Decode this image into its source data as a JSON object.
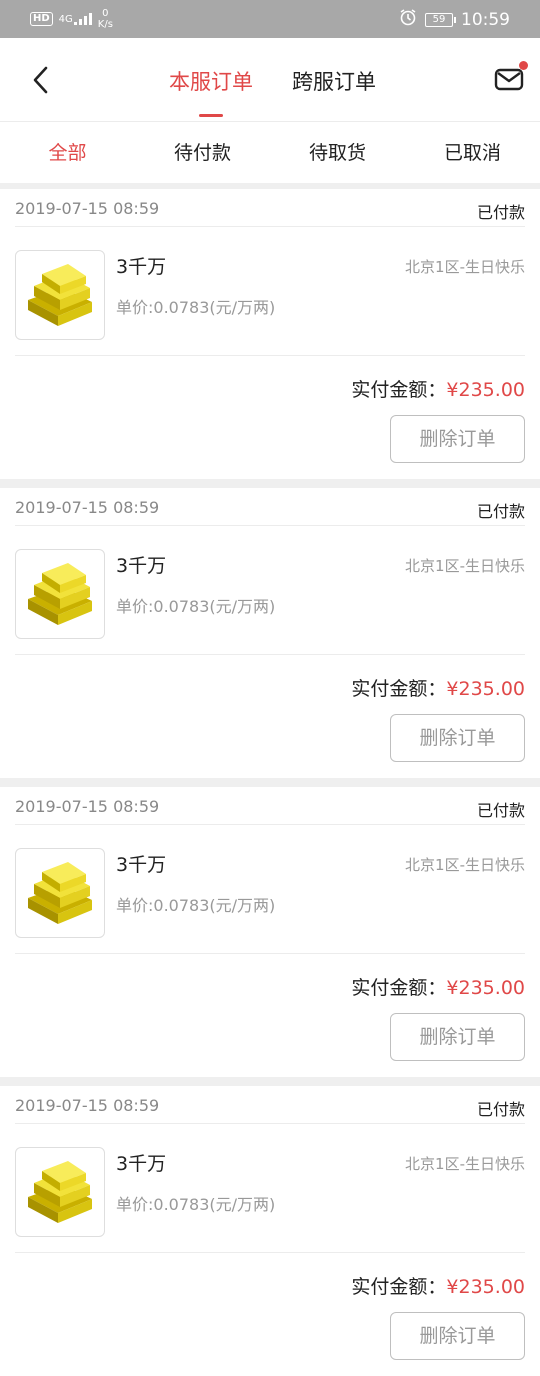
{
  "status_bar": {
    "hd": "HD",
    "network": "4G",
    "speed_value": "0",
    "speed_unit": "K/s",
    "battery": "59",
    "time": "10:59"
  },
  "nav": {
    "tabs": [
      {
        "label": "本服订单",
        "active": true
      },
      {
        "label": "跨服订单",
        "active": false
      }
    ]
  },
  "filters": [
    {
      "label": "全部",
      "active": true
    },
    {
      "label": "待付款",
      "active": false
    },
    {
      "label": "待取货",
      "active": false
    },
    {
      "label": "已取消",
      "active": false
    }
  ],
  "orders": [
    {
      "time": "2019-07-15 08:59",
      "status": "已付款",
      "name": "3千万",
      "server": "北京1区-生日快乐",
      "price": "单价:0.0783(元/万两)",
      "total_label": "实付金额：",
      "total": "¥235.00",
      "delete_label": "删除订单"
    },
    {
      "time": "2019-07-15 08:59",
      "status": "已付款",
      "name": "3千万",
      "server": "北京1区-生日快乐",
      "price": "单价:0.0783(元/万两)",
      "total_label": "实付金额：",
      "total": "¥235.00",
      "delete_label": "删除订单"
    },
    {
      "time": "2019-07-15 08:59",
      "status": "已付款",
      "name": "3千万",
      "server": "北京1区-生日快乐",
      "price": "单价:0.0783(元/万两)",
      "total_label": "实付金额：",
      "total": "¥235.00",
      "delete_label": "删除订单"
    },
    {
      "time": "2019-07-15 08:59",
      "status": "已付款",
      "name": "3千万",
      "server": "北京1区-生日快乐",
      "price": "单价:0.0783(元/万两)",
      "total_label": "实付金额：",
      "total": "¥235.00",
      "delete_label": "删除订单"
    }
  ],
  "colors": {
    "accent": "#e04848",
    "status_bar": "#a8a8a8",
    "gold": "#e8d020"
  }
}
